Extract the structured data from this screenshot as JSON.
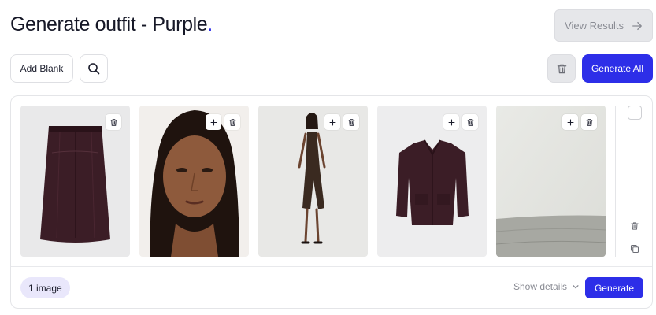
{
  "header": {
    "title": "Generate outfit - Purple",
    "title_dot": ".",
    "view_results_label": "View Results"
  },
  "toolbar": {
    "add_blank_label": "Add Blank",
    "generate_all_label": "Generate All"
  },
  "card": {
    "items": [
      {
        "kind": "leather-skirt",
        "actions": [
          "trash-icon"
        ]
      },
      {
        "kind": "model-portrait",
        "actions": [
          "plus-icon",
          "trash-icon"
        ]
      },
      {
        "kind": "model-full-body",
        "actions": [
          "plus-icon",
          "trash-icon"
        ]
      },
      {
        "kind": "leather-jacket",
        "actions": [
          "plus-icon",
          "trash-icon"
        ]
      },
      {
        "kind": "background-scene",
        "actions": [
          "plus-icon",
          "trash-icon"
        ]
      }
    ],
    "image_count_label": "1 image",
    "show_details_label": "Show details",
    "generate_label": "Generate"
  },
  "colors": {
    "accent": "#2d2ee8",
    "leather_purple": "#3b1d26",
    "badge_bg": "#e9e7fb",
    "disabled_bg": "#e6e7ea"
  }
}
